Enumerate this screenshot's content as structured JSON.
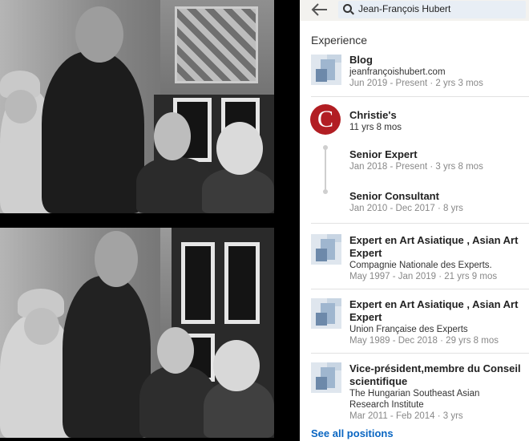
{
  "header": {
    "search_value": "Jean-François Hubert"
  },
  "experience": {
    "section_title": "Experience",
    "see_all": "See all positions",
    "items": [
      {
        "title": "Blog",
        "subtitle": "jeanfrançoishubert.com",
        "meta": "Jun 2019 - Present · 2 yrs 3 mos"
      },
      {
        "company": "Christie's",
        "duration": "11 yrs 8 mos",
        "roles": [
          {
            "title": "Senior Expert",
            "meta": "Jan 2018 - Present · 3 yrs 8 mos"
          },
          {
            "title": "Senior Consultant",
            "meta": "Jan 2010 - Dec 2017 · 8 yrs"
          }
        ]
      },
      {
        "title": "Expert en Art Asiatique , Asian Art Expert",
        "subtitle": "Compagnie Nationale des Experts.",
        "meta": "May 1997 - Jan 2019 · 21 yrs 9 mos"
      },
      {
        "title": "Expert en Art Asiatique , Asian Art Expert",
        "subtitle": "Union Française des Experts",
        "meta": "May 1989 - Dec 2018 · 29 yrs 8 mos"
      },
      {
        "title": "Vice-président,membre du Conseil scientifique",
        "subtitle": "The Hungarian Southeast Asian",
        "subtitle2": "Research Institute",
        "meta": "Mar 2011 - Feb 2014 · 3 yrs"
      }
    ]
  },
  "colors": {
    "link_blue": "#0a66c2",
    "christies_red": "#b21e23"
  },
  "icons": {
    "back": "arrow-left-icon",
    "search": "search-icon"
  }
}
